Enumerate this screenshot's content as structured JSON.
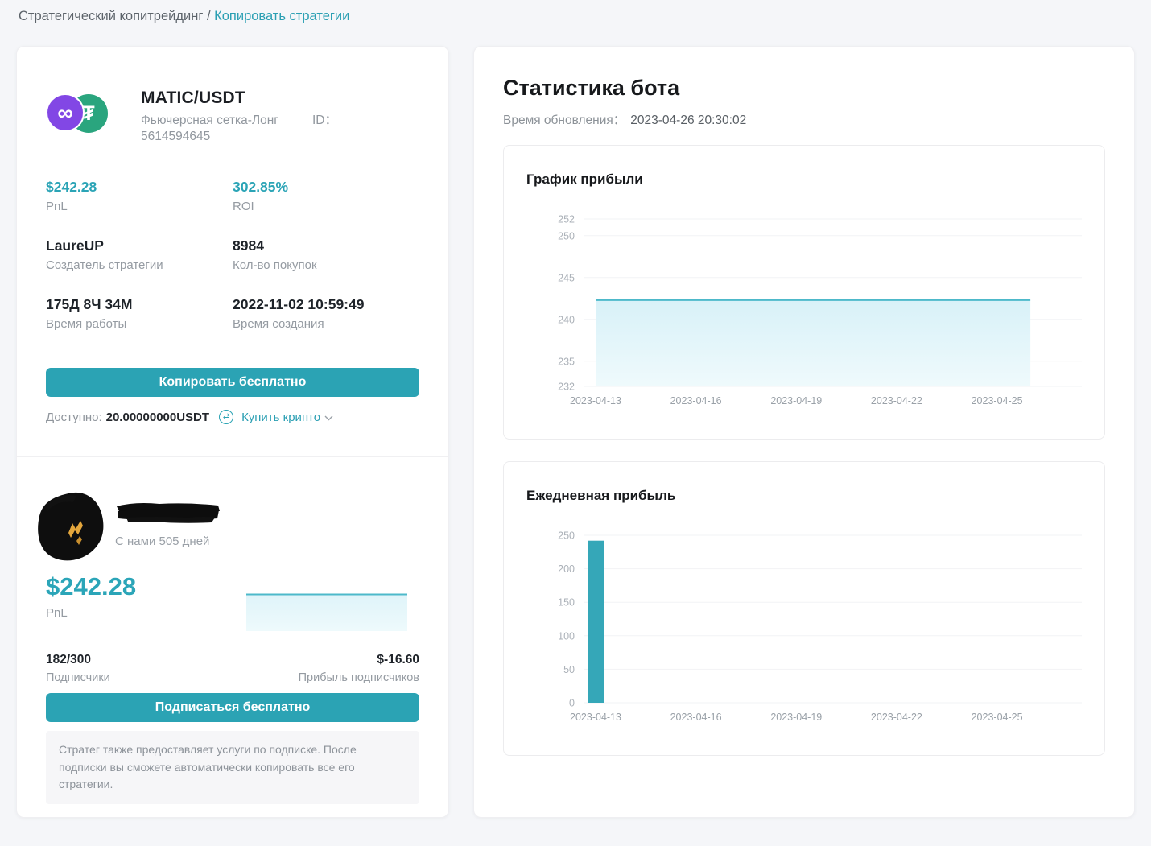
{
  "breadcrumb": {
    "section": "Стратегический копитрейдинг",
    "separator": "/",
    "current": "Копировать стратегии"
  },
  "strategy_card": {
    "pair": "MATIC/USDT",
    "type": "Фьючерсная сетка-Лонг",
    "id_label": "ID：",
    "id_value": "5614594645",
    "coin_icons": [
      "polygon-matic",
      "tether-usdt"
    ],
    "coin_glyphs": {
      "matic": "∞",
      "usdt": "₮"
    },
    "stats": [
      {
        "value": "$242.28",
        "label": "PnL"
      },
      {
        "value": "302.85%",
        "label": "ROI"
      },
      {
        "value": "LaureUP",
        "label": "Создатель стратегии"
      },
      {
        "value": "8984",
        "label": "Кол-во покупок"
      },
      {
        "value": "175Д 8Ч 34М",
        "label": "Время работы"
      },
      {
        "value": "2022-11-02 10:59:49",
        "label": "Время создания"
      }
    ],
    "copy_button": "Копировать бесплатно",
    "available_label": "Доступно:",
    "available_value": "20.00000000USDT",
    "swap_icon_glyph": "⇄",
    "buy_crypto_link": "Купить крипто"
  },
  "strategist_card": {
    "tenure": "С нами 505 дней",
    "pnl_value": "$242.28",
    "pnl_label": "PnL",
    "subscribers_value": "182/300",
    "subscribers_label": "Подписчики",
    "profit_value": "$-16.60",
    "profit_label": "Прибыль подписчиков",
    "subscribe_button": "Подписаться бесплатно",
    "note": "Стратег также предоставляет услуги по подписке. После подписки вы сможете автоматически копировать все его стратегии."
  },
  "stats_panel": {
    "title": "Статистика бота",
    "updated_label": "Время обновления：",
    "updated_value": "2023-04-26 20:30:02"
  },
  "colors": {
    "accent": "#2ba3b4",
    "accent_text": "#2ba5b8",
    "link": "#2b9fb3",
    "chart_line": "#4db9ca",
    "chart_bar": "#35a7b8"
  },
  "chart_data": [
    {
      "type": "area",
      "title": "График прибыли",
      "x": [
        "2023-04-13",
        "2023-04-14",
        "2023-04-15",
        "2023-04-16",
        "2023-04-17",
        "2023-04-18",
        "2023-04-19",
        "2023-04-20",
        "2023-04-21",
        "2023-04-22",
        "2023-04-23",
        "2023-04-24",
        "2023-04-25",
        "2023-04-26"
      ],
      "values": [
        242.3,
        242.3,
        242.3,
        242.3,
        242.3,
        242.3,
        242.3,
        242.3,
        242.3,
        242.3,
        242.3,
        242.3,
        242.3,
        242.3
      ],
      "y_ticks": [
        232,
        235,
        240,
        245,
        250,
        252
      ],
      "x_tick_labels": [
        "2023-04-13",
        "2023-04-16",
        "2023-04-19",
        "2023-04-22",
        "2023-04-25"
      ],
      "ylim": [
        232,
        252
      ],
      "grid": true,
      "legend": "none",
      "line_color": "#4db9ca",
      "fill_top": "#d8f1f8",
      "fill_bottom": "#effafc",
      "grid_color": "#f2f3f5",
      "axis_color": "#abb1b8",
      "xtick_color": "#9aa1a8"
    },
    {
      "type": "bar",
      "title": "Ежедневная прибыль",
      "categories": [
        "2023-04-13",
        "2023-04-14",
        "2023-04-15",
        "2023-04-16",
        "2023-04-17",
        "2023-04-18",
        "2023-04-19",
        "2023-04-20",
        "2023-04-21",
        "2023-04-22",
        "2023-04-23",
        "2023-04-24",
        "2023-04-25",
        "2023-04-26"
      ],
      "values": [
        242,
        0,
        0,
        0,
        0,
        0,
        0,
        0,
        0,
        0,
        0,
        0,
        0,
        0
      ],
      "y_ticks": [
        0,
        50,
        100,
        150,
        200,
        250
      ],
      "x_tick_labels": [
        "2023-04-13",
        "2023-04-16",
        "2023-04-19",
        "2023-04-22",
        "2023-04-25"
      ],
      "ylim": [
        0,
        250
      ],
      "grid": true,
      "legend": "none",
      "bar_color": "#35a7b8",
      "grid_color": "#f2f3f5",
      "axis_color": "#abb1b8",
      "xtick_color": "#9aa1a8"
    }
  ]
}
